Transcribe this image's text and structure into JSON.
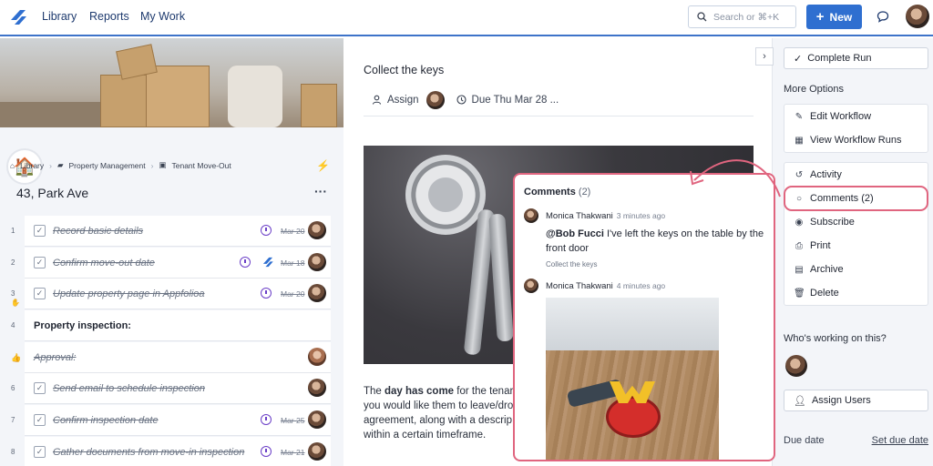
{
  "nav": {
    "links": [
      "Library",
      "Reports",
      "My Work"
    ],
    "search_placeholder": "Search or ⌘+K",
    "new_label": "New",
    "brand_color": "#2f6fd0"
  },
  "left": {
    "breadcrumb": [
      "Library",
      "Property Management",
      "Tenant Move-Out"
    ],
    "run_title": "43, Park Ave",
    "more_label": "···",
    "tasks": [
      {
        "num": "1",
        "label": "Record basic details",
        "date": "Mar 20",
        "done": true
      },
      {
        "num": "2",
        "label": "Confirm move-out date",
        "date": "Mar 18",
        "done": true
      },
      {
        "num": "3",
        "label": "Update property page in Appfolioa",
        "date": "Mar 20",
        "done": true
      },
      {
        "num": "4",
        "label": "Property inspection:",
        "date": "",
        "done": false
      },
      {
        "num": "5",
        "label": "Approval:",
        "date": "",
        "done": true
      },
      {
        "num": "6",
        "label": "Send email to schedule inspection",
        "date": "",
        "done": true
      },
      {
        "num": "7",
        "label": "Confirm inspection date",
        "date": "Mar 25",
        "done": true
      },
      {
        "num": "8",
        "label": "Gather documents from move-in inspection",
        "date": "Mar 21",
        "done": true
      }
    ]
  },
  "main": {
    "task_title": "Collect the keys",
    "assign_label": "Assign",
    "due_label": "Due Thu Mar 28 ...",
    "body_parts": [
      "The ",
      "day has come",
      " for the tenar",
      "you would like them to leave/dro",
      "agreement, along with a descrip",
      "within a certain timeframe."
    ]
  },
  "comments": {
    "title": "Comments",
    "count": "(2)",
    "items": [
      {
        "author": "Monica Thakwani",
        "time": "3 minutes ago",
        "mention": "@Bob Fucci",
        "text": " I've left the keys on the table by the front door",
        "task": "Collect the keys"
      },
      {
        "author": "Monica Thakwani",
        "time": "4 minutes ago"
      }
    ]
  },
  "right": {
    "complete_label": "Complete Run",
    "more_options_label": "More Options",
    "group1": [
      {
        "icon": "edit-icon",
        "label": "Edit Workflow"
      },
      {
        "icon": "table-icon",
        "label": "View Workflow Runs"
      }
    ],
    "group2": [
      {
        "icon": "history-icon",
        "label": "Activity"
      },
      {
        "icon": "comment-icon",
        "label": "Comments (2)"
      },
      {
        "icon": "eye-icon",
        "label": "Subscribe"
      },
      {
        "icon": "print-icon",
        "label": "Print"
      },
      {
        "icon": "archive-icon",
        "label": "Archive"
      },
      {
        "icon": "trash-icon",
        "label": "Delete"
      }
    ],
    "working_label": "Who's working on this?",
    "assign_users_label": "Assign Users",
    "due_date_label": "Due date",
    "set_due_date_label": "Set due date"
  },
  "highlight_color": "#e0657f"
}
